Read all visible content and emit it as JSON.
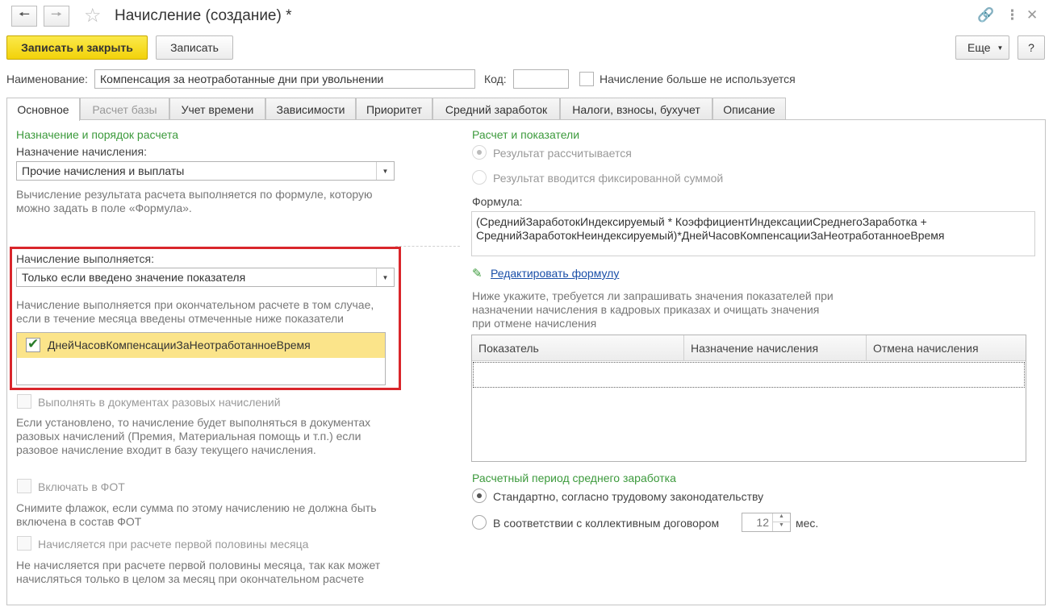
{
  "window": {
    "title": "Начисление (создание) *"
  },
  "toolbar": {
    "save_close": "Записать и закрыть",
    "save": "Записать",
    "more": "Еще",
    "help": "?"
  },
  "header": {
    "name_label": "Наименование:",
    "name_value": "Компенсация за неотработанные дни при увольнении",
    "code_label": "Код:",
    "code_value": "",
    "not_used_label": "Начисление больше не используется"
  },
  "tabs": [
    {
      "label": "Основное"
    },
    {
      "label": "Расчет базы"
    },
    {
      "label": "Учет времени"
    },
    {
      "label": "Зависимости"
    },
    {
      "label": "Приоритет"
    },
    {
      "label": "Средний заработок"
    },
    {
      "label": "Налоги, взносы, бухучет"
    },
    {
      "label": "Описание"
    }
  ],
  "left": {
    "section_title": "Назначение и порядок расчета",
    "purpose_label": "Назначение начисления:",
    "purpose_value": "Прочие начисления и выплаты",
    "purpose_hint": "Вычисление результата расчета выполняется по формуле, которую можно задать в поле «Формула».",
    "performed_label": "Начисление выполняется:",
    "performed_value": "Только если введено значение показателя",
    "performed_hint": "Начисление выполняется при окончательном расчете в том случае, если в течение месяца введены отмеченные ниже показатели",
    "indicator_item": "ДнейЧасовКомпенсацииЗаНеотработанноеВремя",
    "one_time_label": "Выполнять в документах разовых начислений",
    "one_time_hint": "Если установлено, то начисление будет выполняться в документах разовых начислений (Премия, Материальная помощь и т.п.) если разовое начисление входит в базу текущего начисления.",
    "fot_label": "Включать в ФОТ",
    "fot_hint": "Снимите флажок, если сумма по этому начислению не должна быть включена в состав ФОТ",
    "first_half_label": "Начисляется при расчете первой половины месяца",
    "first_half_hint": "Не начисляется при расчете первой половины месяца, так как может начисляться только в целом за месяц при окончательном расчете"
  },
  "right": {
    "section_title": "Расчет и показатели",
    "radio_calc": "Результат рассчитывается",
    "radio_fixed": "Результат вводится фиксированной суммой",
    "formula_label": "Формула:",
    "formula_line1": "(СреднийЗаработокИндексируемый * КоэффициентИндексацииСреднегоЗаработка +",
    "formula_line2": "СреднийЗаработокНеиндексируемый)*ДнейЧасовКомпенсацииЗаНеотработанноеВремя",
    "edit_formula": "Редактировать формулу",
    "indicators_hint": "Ниже укажите, требуется ли запрашивать значения показателей при назначении начисления в кадровых приказах и очищать значения при отмене начисления",
    "table_headers": [
      "Показатель",
      "Назначение начисления",
      "Отмена начисления"
    ],
    "period_title": "Расчетный период среднего заработка",
    "period_standard": "Стандартно, согласно трудовому законодательству",
    "period_collective": "В соответствии с коллективным договором",
    "months_value": "12",
    "months_unit": "мес."
  },
  "colors": {
    "accent_yellow": "#f5d81c",
    "section_green": "#3c9a3c",
    "highlight_red": "#d9262b",
    "row_highlight": "#fbe48a"
  }
}
